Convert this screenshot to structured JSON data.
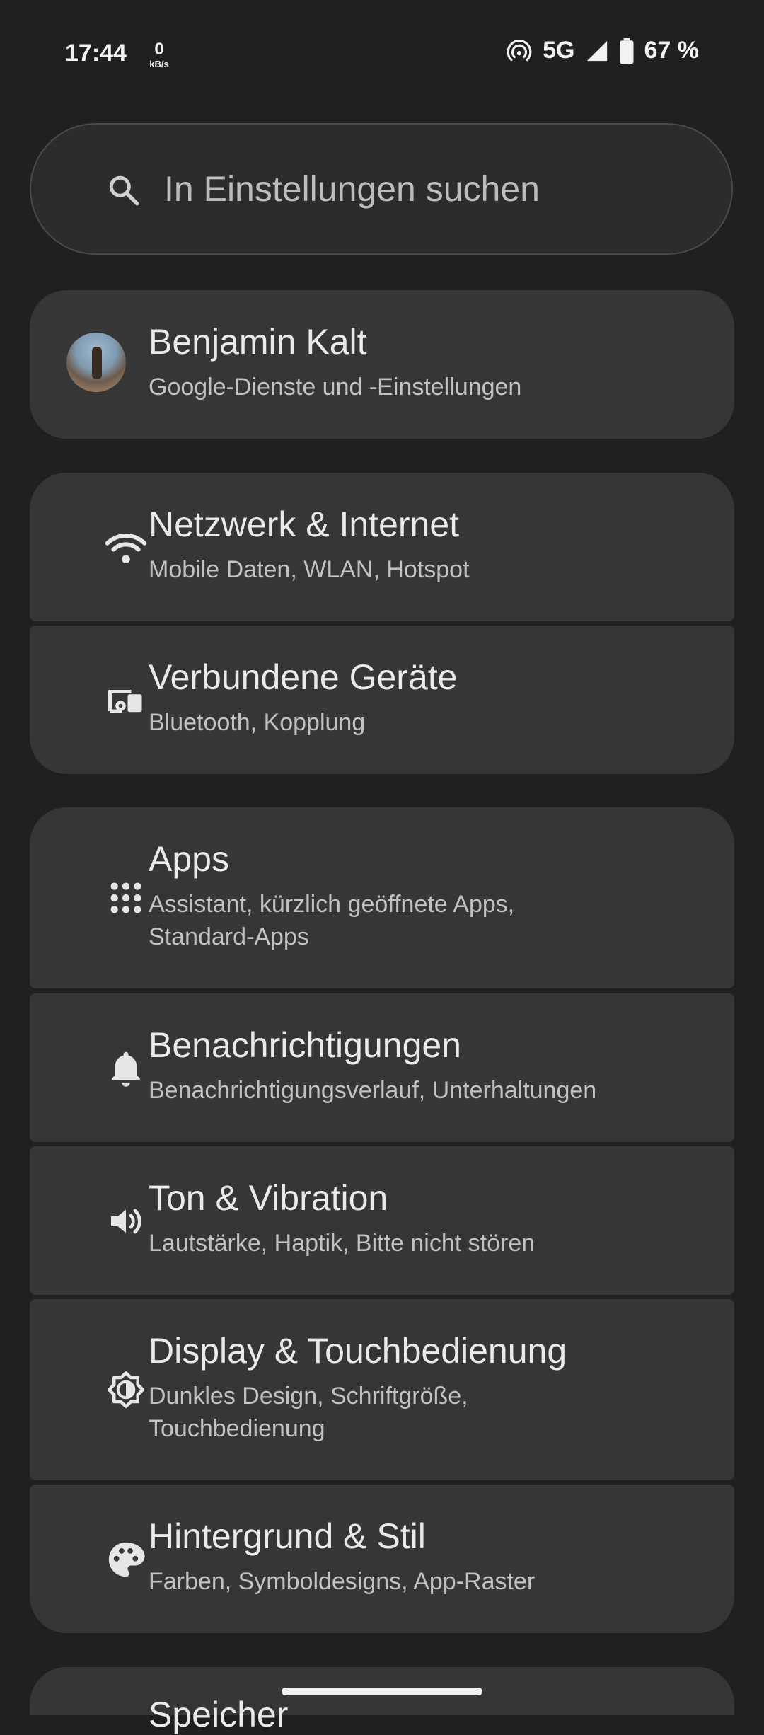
{
  "status_bar": {
    "time": "17:44",
    "net_speed_value": "0",
    "net_speed_unit": "kB/s",
    "network_type": "5G",
    "battery_percent": "67 %"
  },
  "search": {
    "placeholder": "In Einstellungen suchen"
  },
  "account": {
    "name": "Benjamin Kalt",
    "subtitle": "Google-Dienste und -Einstellungen"
  },
  "items": [
    {
      "title": "Netzwerk & Internet",
      "subtitle": "Mobile Daten, WLAN, Hotspot",
      "icon": "wifi-icon"
    },
    {
      "title": "Verbundene Geräte",
      "subtitle": "Bluetooth, Kopplung",
      "icon": "connected-devices-icon"
    },
    {
      "title": "Apps",
      "subtitle": "Assistant, kürzlich geöffnete Apps, Standard-Apps",
      "icon": "apps-grid-icon"
    },
    {
      "title": "Benachrichtigungen",
      "subtitle": "Benachrichtigungsverlauf, Unterhaltungen",
      "icon": "bell-icon"
    },
    {
      "title": "Ton & Vibration",
      "subtitle": "Lautstärke, Haptik, Bitte nicht stören",
      "icon": "volume-icon"
    },
    {
      "title": "Display & Touchbedienung",
      "subtitle": "Dunkles Design, Schriftgröße, Touchbedienung",
      "icon": "brightness-icon"
    },
    {
      "title": "Hintergrund & Stil",
      "subtitle": "Farben, Symboldesigns, App-Raster",
      "icon": "palette-icon"
    },
    {
      "title": "Speicher",
      "icon": "storage-icon"
    }
  ],
  "colors": {
    "background": "#202020",
    "card": "#363636",
    "text": "#eaeaea",
    "subtext": "#c2c2c2"
  }
}
